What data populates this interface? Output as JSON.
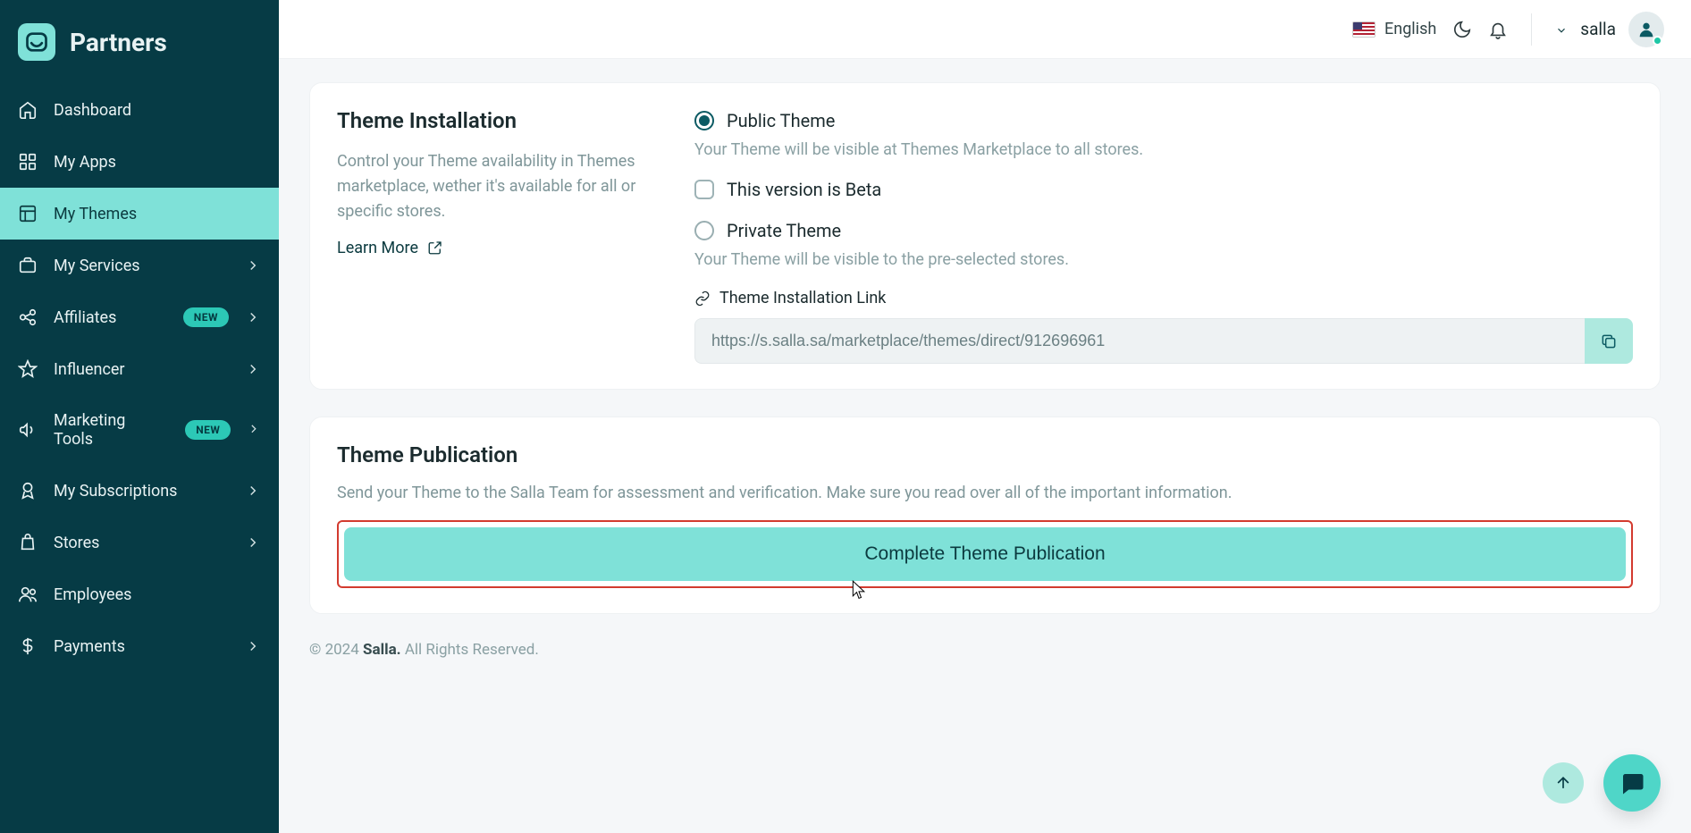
{
  "brand": "Partners",
  "sidebar": {
    "items": [
      {
        "label": "Dashboard"
      },
      {
        "label": "My Apps"
      },
      {
        "label": "My Themes"
      },
      {
        "label": "My Services"
      },
      {
        "label": "Affiliates",
        "badge": "NEW"
      },
      {
        "label": "Influencer"
      },
      {
        "label": "Marketing Tools",
        "badge": "NEW"
      },
      {
        "label": "My Subscriptions"
      },
      {
        "label": "Stores"
      },
      {
        "label": "Employees"
      },
      {
        "label": "Payments"
      }
    ]
  },
  "header": {
    "language": "English",
    "user": "salla"
  },
  "installation": {
    "title": "Theme Installation",
    "desc": "Control your Theme availability in Themes marketplace, wether it's available for all or specific stores.",
    "learn_more": "Learn More",
    "public_label": "Public Theme",
    "public_hint": "Your Theme will be visible at Themes Marketplace to all stores.",
    "beta_label": "This version is Beta",
    "private_label": "Private Theme",
    "private_hint": "Your Theme will be visible to the pre-selected stores.",
    "link_label": "Theme Installation Link",
    "link_value": "https://s.salla.sa/marketplace/themes/direct/912696961"
  },
  "publication": {
    "title": "Theme Publication",
    "desc": "Send your Theme to the Salla Team for assessment and verification. Make sure you read over all of the important information.",
    "button": "Complete Theme Publication"
  },
  "footer": {
    "prefix": "© 2024 ",
    "brand": "Salla.",
    "suffix": " All Rights Reserved."
  }
}
